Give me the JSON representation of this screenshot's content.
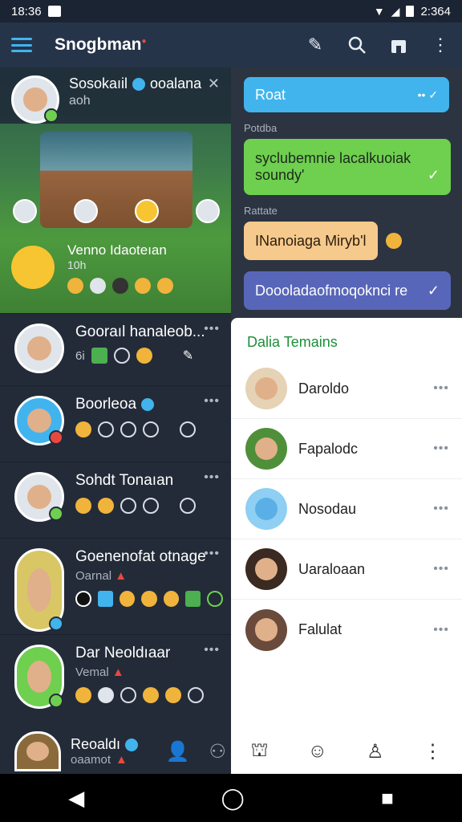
{
  "status": {
    "time": "18:36",
    "battery_text": "2:364"
  },
  "appbar": {
    "title": "Snogbman",
    "icons": [
      "menu-icon",
      "feather-icon",
      "search-icon",
      "store-icon",
      "more-vert-icon"
    ]
  },
  "feature": {
    "name": "Sosokaıil",
    "handle": "ooalana",
    "sub": "aoh",
    "title": "Venno Idaoteıan",
    "sub2": "10h"
  },
  "chats": [
    {
      "name": "Gooraıl hanaleob...",
      "sub": "6i"
    },
    {
      "name": "Boorleoa",
      "sub": ""
    },
    {
      "name": "Sohdt Tonaıan",
      "sub": ""
    },
    {
      "name": "Goenenofat otnage",
      "sub": "Oarnal"
    },
    {
      "name": "Dar Neoldıaar",
      "sub": "Vemal"
    },
    {
      "name": "Reoaldı",
      "sub": "oaamot"
    }
  ],
  "thread": {
    "reply_bubble": "Roat",
    "label1": "Potdba",
    "green_bubble_l1": "syclubemnie lacalkuoiak",
    "green_bubble_l2": "soundy'",
    "label2": "Rattate",
    "orange_bubble": "INanoiaga Miryb'l",
    "blue_bubble": "Doooladaofmoqoknci re"
  },
  "popup": {
    "title": "Dalia Temains",
    "members": [
      "Daroldo",
      "Fapalodc",
      "Nosodau",
      "Uaraloaan",
      "Falulat"
    ]
  },
  "colors": {
    "accent": "#41b4ee",
    "green": "#6fcf4f",
    "orange": "#f6c98c",
    "purple": "#5866b9",
    "popup_title": "#1c8f3a"
  }
}
